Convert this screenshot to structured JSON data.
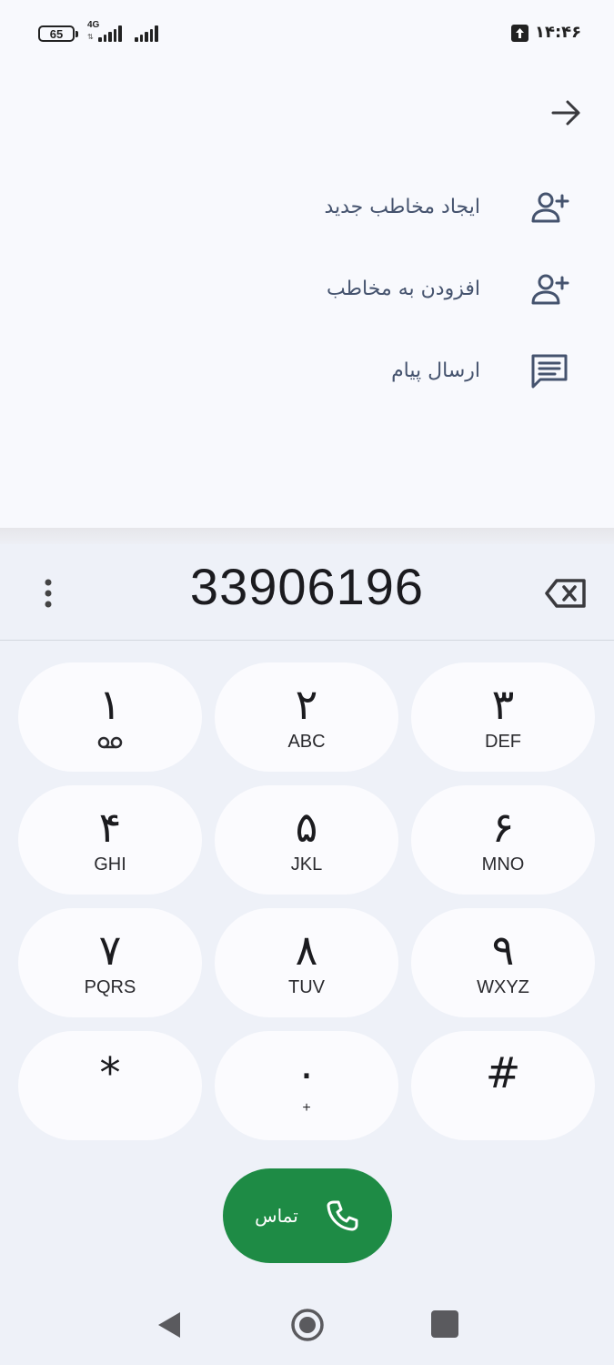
{
  "status_bar": {
    "battery_level": "65",
    "network_type": "4G",
    "time": "۱۴:۴۶"
  },
  "actions": [
    {
      "label": "ایجاد مخاطب جدید",
      "icon": "person-add-icon"
    },
    {
      "label": "افزودن به مخاطب",
      "icon": "person-add-icon"
    },
    {
      "label": "ارسال پیام",
      "icon": "message-icon"
    }
  ],
  "dialer": {
    "number": "33906196",
    "keys": [
      {
        "digit": "۱",
        "letters": "",
        "sub_icon": "voicemail-icon"
      },
      {
        "digit": "۲",
        "letters": "ABC"
      },
      {
        "digit": "۳",
        "letters": "DEF"
      },
      {
        "digit": "۴",
        "letters": "GHI"
      },
      {
        "digit": "۵",
        "letters": "JKL"
      },
      {
        "digit": "۶",
        "letters": "MNO"
      },
      {
        "digit": "۷",
        "letters": "PQRS"
      },
      {
        "digit": "۸",
        "letters": "TUV"
      },
      {
        "digit": "۹",
        "letters": "WXYZ"
      },
      {
        "digit": "*",
        "letters": ""
      },
      {
        "digit": "۰",
        "letters": "+"
      },
      {
        "digit": "#",
        "letters": ""
      }
    ],
    "call_label": "تماس"
  },
  "colors": {
    "background": "#f8f9fd",
    "dialer_background": "#eef1f8",
    "key_background": "#fbfbfe",
    "call_green": "#1e8b45",
    "action_text": "#45536e"
  }
}
